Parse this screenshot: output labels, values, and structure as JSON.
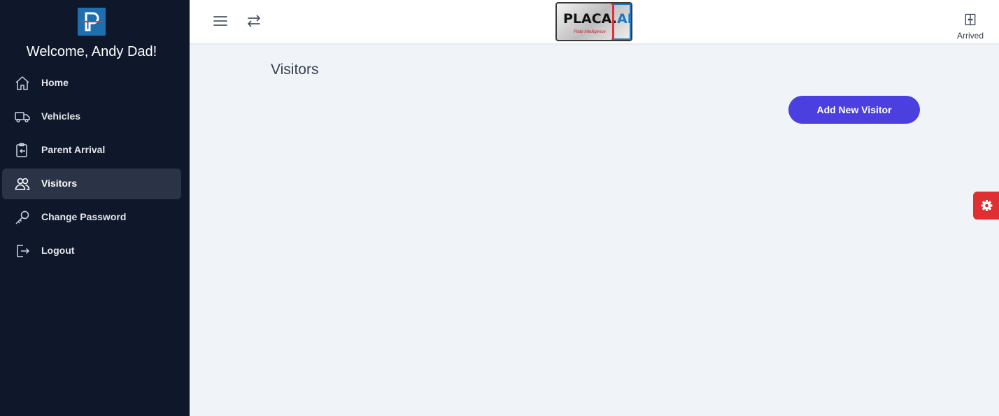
{
  "sidebar": {
    "welcome": "Welcome, Andy Dad!",
    "items": [
      {
        "label": "Home",
        "icon": "home-icon"
      },
      {
        "label": "Vehicles",
        "icon": "truck-icon"
      },
      {
        "label": "Parent Arrival",
        "icon": "clipboard-arrow-icon"
      },
      {
        "label": "Visitors",
        "icon": "users-icon",
        "active": true
      },
      {
        "label": "Change Password",
        "icon": "key-icon"
      },
      {
        "label": "Logout",
        "icon": "logout-icon"
      }
    ]
  },
  "header": {
    "logo_text": "PLACA.",
    "logo_text_ai": "AI",
    "logo_tagline": "Plate Intelligence",
    "arrived_label": "Arrived"
  },
  "main": {
    "title": "Visitors",
    "add_button_label": "Add New Visitor"
  },
  "colors": {
    "sidebar_bg": "#0f172a",
    "accent": "#4b3fe0",
    "settings_red": "#e02f33"
  }
}
